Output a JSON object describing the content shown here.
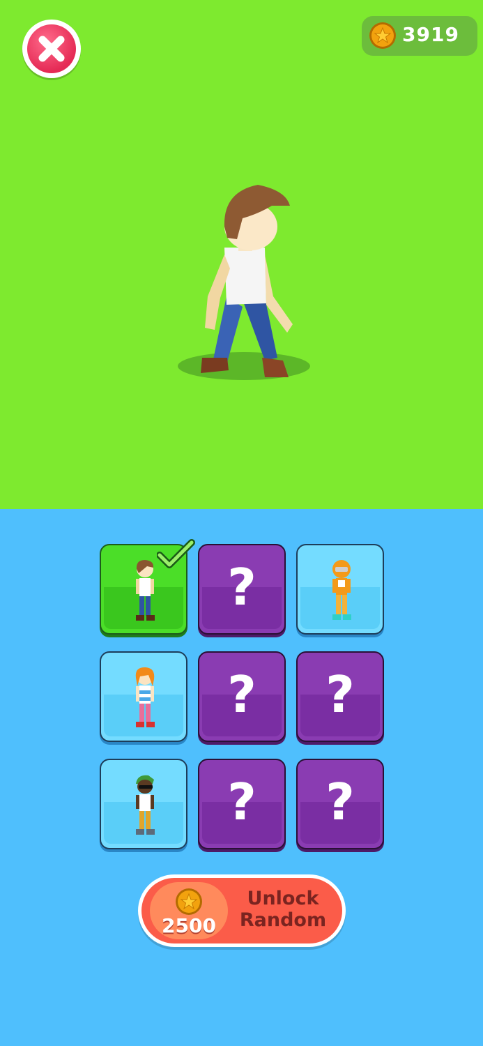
{
  "topbar": {
    "close_icon": "close-x-icon",
    "coins": "3919",
    "coin_icon": "star-coin-icon"
  },
  "preview": {
    "character": "boy-brown-hair-white-tank-blue-jeans"
  },
  "grid": {
    "tiles": [
      {
        "state": "selected",
        "character": "boy-brown-hair",
        "selected_icon": "checkmark-icon"
      },
      {
        "state": "locked",
        "label": "?"
      },
      {
        "state": "unlocked",
        "character": "orange-robot-helmet"
      },
      {
        "state": "unlocked",
        "character": "orange-hair-girl"
      },
      {
        "state": "locked",
        "label": "?"
      },
      {
        "state": "locked",
        "label": "?"
      },
      {
        "state": "unlocked",
        "character": "green-hat-sunglasses"
      },
      {
        "state": "locked",
        "label": "?"
      },
      {
        "state": "locked",
        "label": "?"
      }
    ]
  },
  "unlock": {
    "price": "2500",
    "line1": "Unlock",
    "line2": "Random"
  },
  "colors": {
    "stage_bg": "#7eea2f",
    "panel_bg": "#4fbffd",
    "tile_selected": "#4bde28",
    "tile_unlocked": "#74dcff",
    "tile_locked": "#8a3cb2",
    "button": "#fb5c49"
  }
}
